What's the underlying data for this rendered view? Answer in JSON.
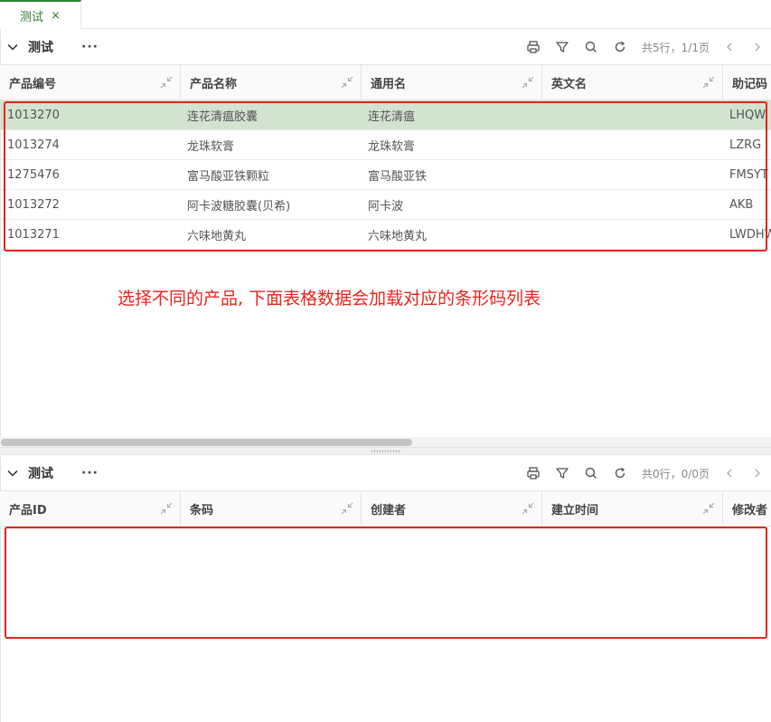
{
  "tab": {
    "label": "测试",
    "close": "×"
  },
  "top_panel": {
    "title": "测试",
    "more": "···",
    "count_text": "共5行，1/1页",
    "columns": [
      "产品编号",
      "产品名称",
      "通用名",
      "英文名",
      "助记码"
    ],
    "rows": [
      {
        "code": "1013270",
        "name": "连花清瘟胶囊",
        "generic": "连花清瘟",
        "english": "",
        "mnemonic": "LHQW"
      },
      {
        "code": "1013274",
        "name": "龙珠软膏",
        "generic": "龙珠软膏",
        "english": "",
        "mnemonic": "LZRG"
      },
      {
        "code": "1275476",
        "name": "富马酸亚铁颗粒",
        "generic": "富马酸亚铁",
        "english": "",
        "mnemonic": "FMSYT"
      },
      {
        "code": "1013272",
        "name": "阿卡波糖胶囊(贝希)",
        "generic": "阿卡波",
        "english": "",
        "mnemonic": "AKB"
      },
      {
        "code": "1013271",
        "name": "六味地黄丸",
        "generic": "六味地黄丸",
        "english": "",
        "mnemonic": "LWDHW"
      }
    ],
    "selected_row": 0
  },
  "annotation": {
    "text": "选择不同的产品, 下面表格数据会加载对应的条形码列表",
    "color": "#e8241b"
  },
  "bottom_panel": {
    "title": "测试",
    "more": "···",
    "count_text": "共0行，0/0页",
    "columns": [
      "产品ID",
      "条码",
      "创建者",
      "建立时间",
      "修改者"
    ]
  },
  "colors": {
    "accent": "#2f7d32",
    "selected_row": "#d2e3d0",
    "annotation": "#e8241b"
  },
  "icons": [
    "collapse-chevron-icon",
    "print-icon",
    "filter-icon",
    "search-icon",
    "refresh-icon",
    "prev-page-icon",
    "next-page-icon",
    "shrink-column-icon",
    "close-icon"
  ]
}
